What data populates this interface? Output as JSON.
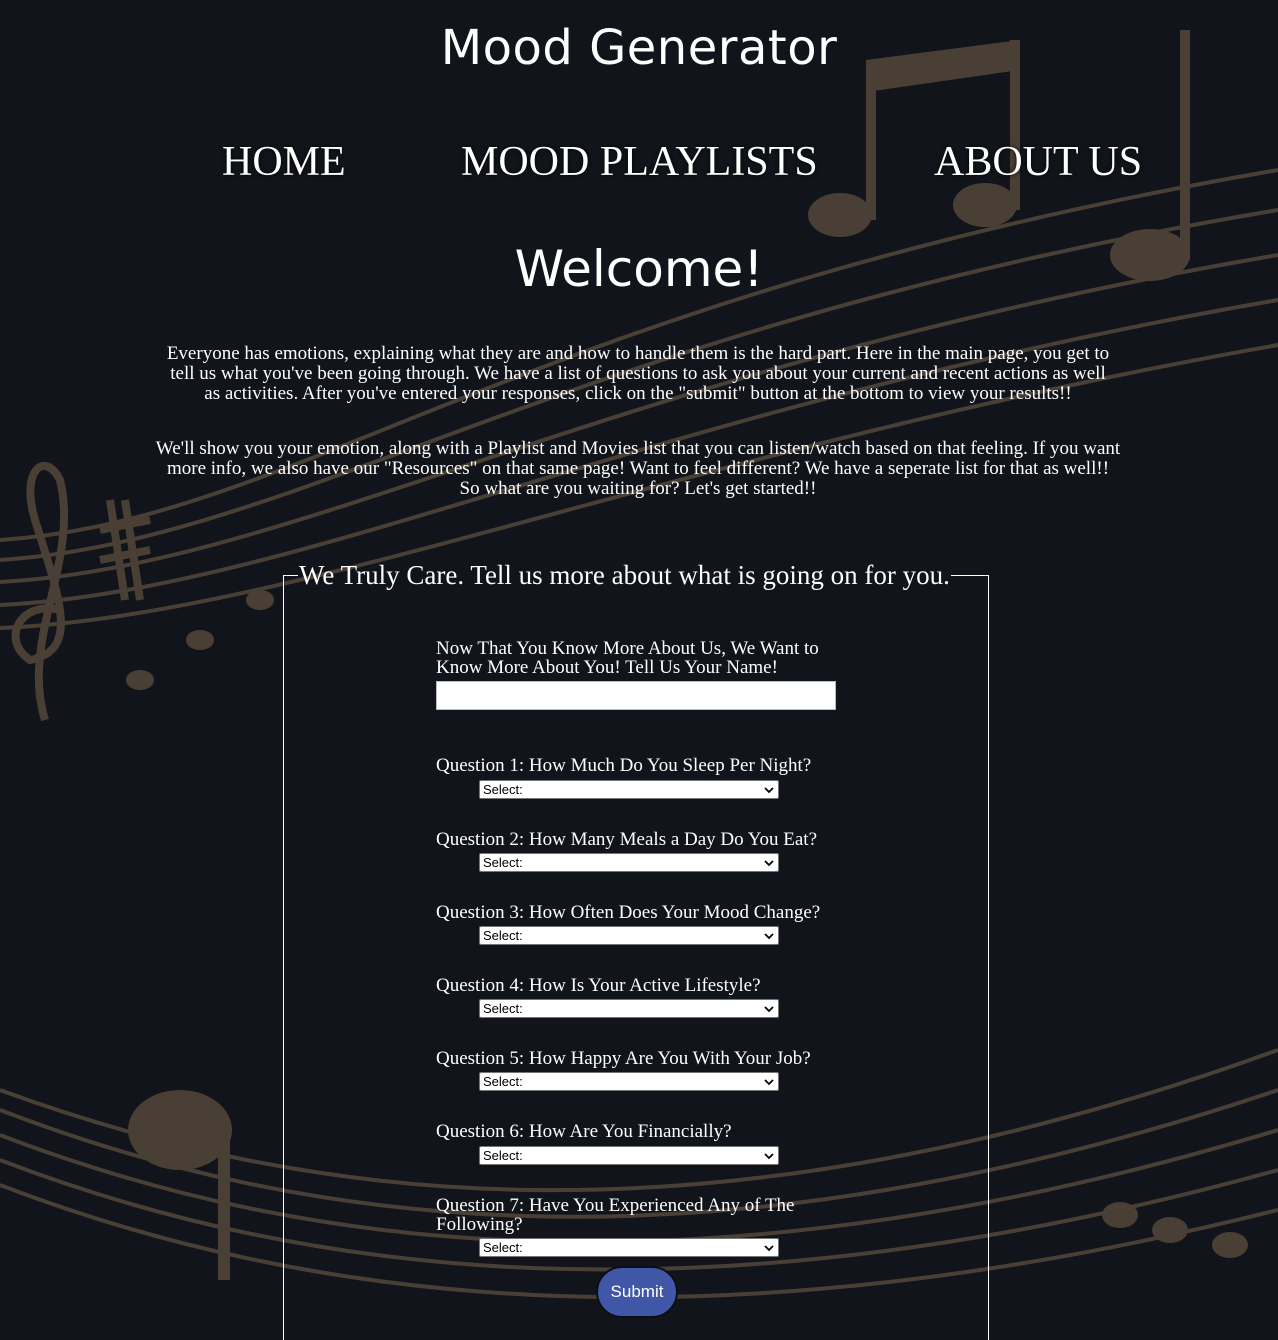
{
  "site_title": "Mood Generator",
  "nav": {
    "home": "HOME",
    "playlists": "MOOD PLAYLISTS",
    "about": "ABOUT US"
  },
  "welcome": "Welcome!",
  "intro": [
    "Everyone has emotions, explaining what they are and how to handle them is the hard part. Here in the main page, you get to tell us what you've been going through. We have a list of questions to ask you about your current and recent actions as well as activities. After you've entered your responses, click on the \"submit\" button at the bottom to view your results!!",
    "We'll show you your emotion, along with a Playlist and Movies list that you can listen/watch based on that feeling. If you want more info, we also have our \"Resources\" on that same page! Want to feel different? We have a seperate list for that as well!! So what are you waiting for? Let's get started!!"
  ],
  "form": {
    "legend": "We Truly Care. Tell us more about what is going on for you.",
    "name_label": "Now That You Know More About Us, We Want to Know More About You! Tell Us Your Name!",
    "name_value": "",
    "questions": [
      {
        "label": "Question 1: How Much Do You Sleep Per Night?",
        "selected": "Select:"
      },
      {
        "label": "Question 2: How Many Meals a Day Do You Eat?",
        "selected": "Select:"
      },
      {
        "label": "Question 3: How Often Does Your Mood Change?",
        "selected": "Select:"
      },
      {
        "label": "Question 4: How Is Your Active Lifestyle?",
        "selected": "Select:"
      },
      {
        "label": "Question 5: How Happy Are You With Your Job?",
        "selected": "Select:"
      },
      {
        "label": "Question 6: How Are You Financially?",
        "selected": "Select:"
      },
      {
        "label": "Question 7: Have You Experienced Any of The Following?",
        "selected": "Select:"
      }
    ],
    "submit_label": "Submit"
  },
  "colors": {
    "background": "#11141a",
    "music_notes": "#4a3f35",
    "submit_button": "#3f57a6",
    "text": "#ffffff"
  },
  "background_image": "music-notes-staff-decoration"
}
